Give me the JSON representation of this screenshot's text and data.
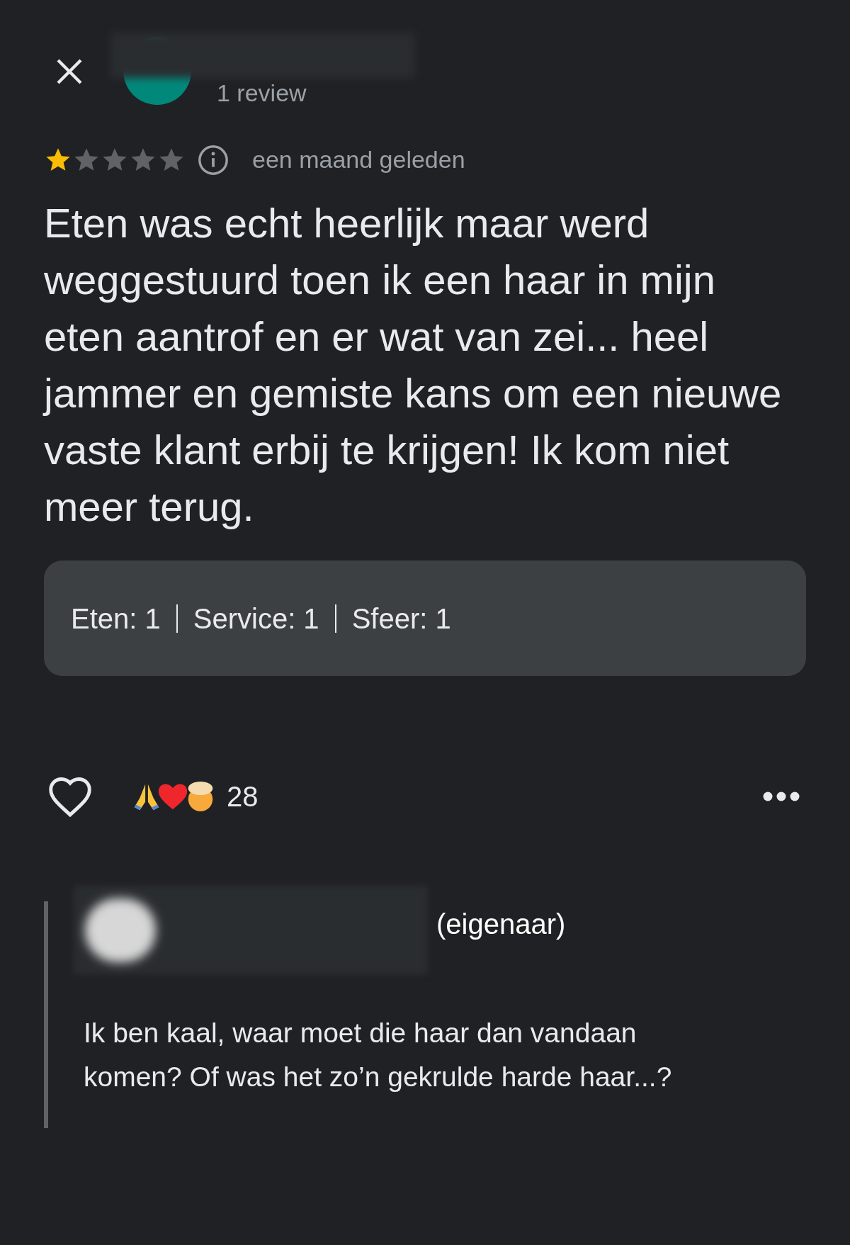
{
  "reviewer": {
    "review_count": "1 review"
  },
  "review": {
    "stars": 1,
    "date": "een maand geleden",
    "text": "Eten was echt heerlijk maar werd weggestuurd toen ik een haar in mijn eten aantrof en er wat van zei... heel jammer en gemiste kans om een nieuwe vaste klant erbij te krijgen! Ik kom niet meer terug."
  },
  "ratings": [
    "Eten: 1",
    "Service: 1",
    "Sfeer: 1"
  ],
  "reactions": {
    "count": "28"
  },
  "owner_reply": {
    "role": "(eigenaar)",
    "text": "Ik ben kaal, waar moet die haar dan vandaan komen? Of was het zo’n gekrulde harde haar...?"
  }
}
